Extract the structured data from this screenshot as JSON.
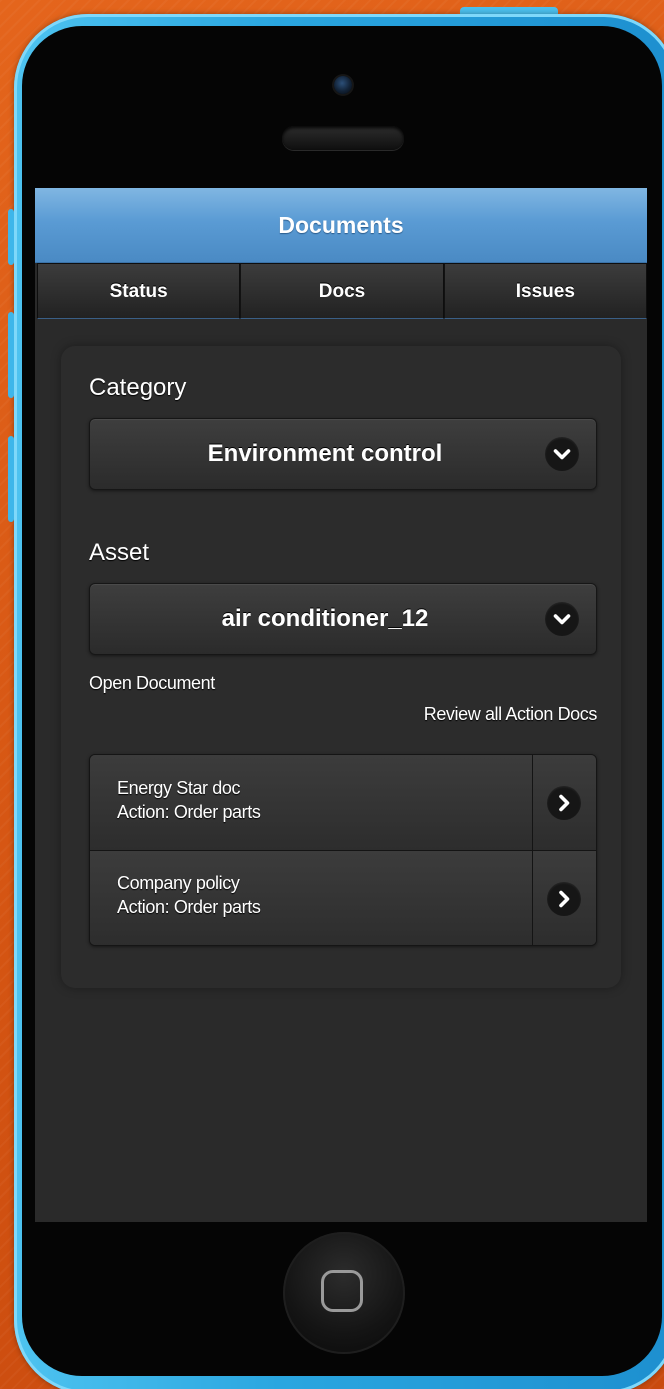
{
  "app": {
    "title": "Documents"
  },
  "tabs": [
    {
      "label": "Status"
    },
    {
      "label": "Docs"
    },
    {
      "label": "Issues"
    }
  ],
  "category": {
    "label": "Category",
    "selected": "Environment control",
    "icon": "chevron-down-icon"
  },
  "asset": {
    "label": "Asset",
    "selected": "air conditioner_12",
    "icon": "chevron-down-icon"
  },
  "links": {
    "open_document": "Open Document",
    "review_all": "Review all Action Docs"
  },
  "documents": [
    {
      "title": "Energy Star doc",
      "action": "Action: Order parts",
      "icon": "chevron-right-icon"
    },
    {
      "title": "Company policy",
      "action": "Action: Order parts",
      "icon": "chevron-right-icon"
    }
  ],
  "colors": {
    "header": "#5a9bd4",
    "phone_frame": "#2aa6e0",
    "background": "#d55513",
    "screen_bg": "#2a2a2a"
  }
}
